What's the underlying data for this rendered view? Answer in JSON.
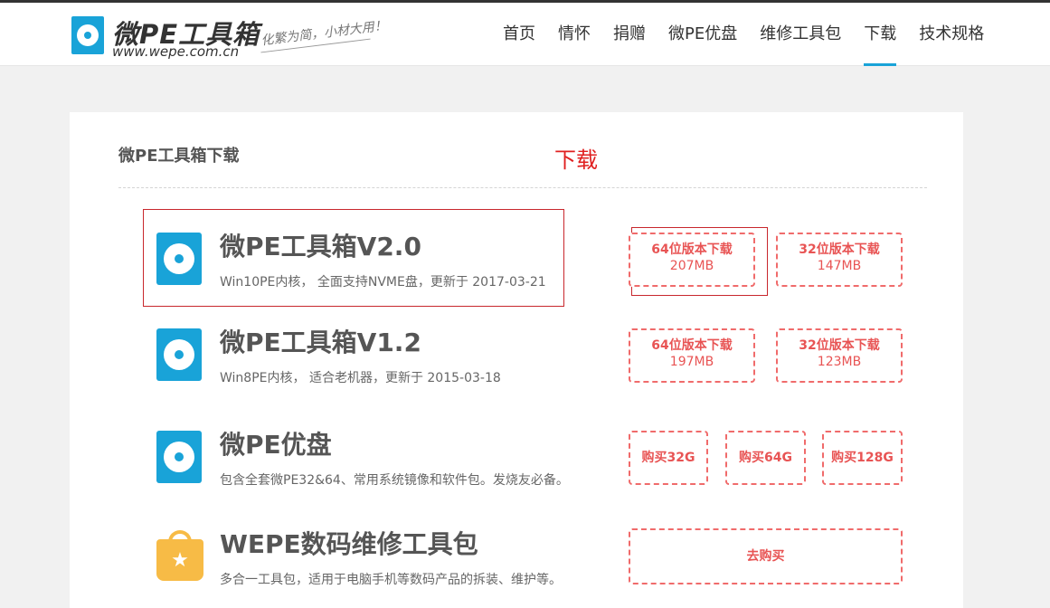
{
  "site": {
    "name": "微PE工具箱",
    "url": "www.wepe.com.cn",
    "slogan": "化繁为简，小材大用！"
  },
  "nav": {
    "items": [
      "首页",
      "情怀",
      "捐赠",
      "微PE优盘",
      "维修工具包",
      "下载",
      "技术规格"
    ],
    "active": "下载"
  },
  "section": {
    "title": "微PE工具箱下载",
    "annotation": "下载"
  },
  "products": [
    {
      "icon": "disc-icon",
      "title": "微PE工具箱V2.0",
      "desc": "Win10PE内核， 全面支持NVME盘，更新于 2017-03-21",
      "buttons": [
        {
          "label": "64位版本下载",
          "size": "207MB"
        },
        {
          "label": "32位版本下载",
          "size": "147MB"
        }
      ]
    },
    {
      "icon": "disc-icon",
      "title": "微PE工具箱V1.2",
      "desc": "Win8PE内核， 适合老机器，更新于 2015-03-18",
      "buttons": [
        {
          "label": "64位版本下载",
          "size": "197MB"
        },
        {
          "label": "32位版本下载",
          "size": "123MB"
        }
      ]
    },
    {
      "icon": "disc-icon",
      "title": "微PE优盘",
      "desc": "包含全套微PE32&64、常用系统镜像和软件包。发烧友必备。",
      "buttons": [
        {
          "label": "购买32G"
        },
        {
          "label": "购买64G"
        },
        {
          "label": "购买128G"
        }
      ]
    },
    {
      "icon": "shopping-bag-icon",
      "title": "WEPE数码维修工具包",
      "desc": "多合一工具包，适用于电脑手机等数码产品的拆装、维护等。",
      "buttons": [
        {
          "label": "去购买"
        }
      ]
    }
  ],
  "colors": {
    "brand": "#19a3d8",
    "button_red": "#e85454",
    "annotation_red": "#c8272d",
    "bag_yellow": "#f7bb46"
  }
}
